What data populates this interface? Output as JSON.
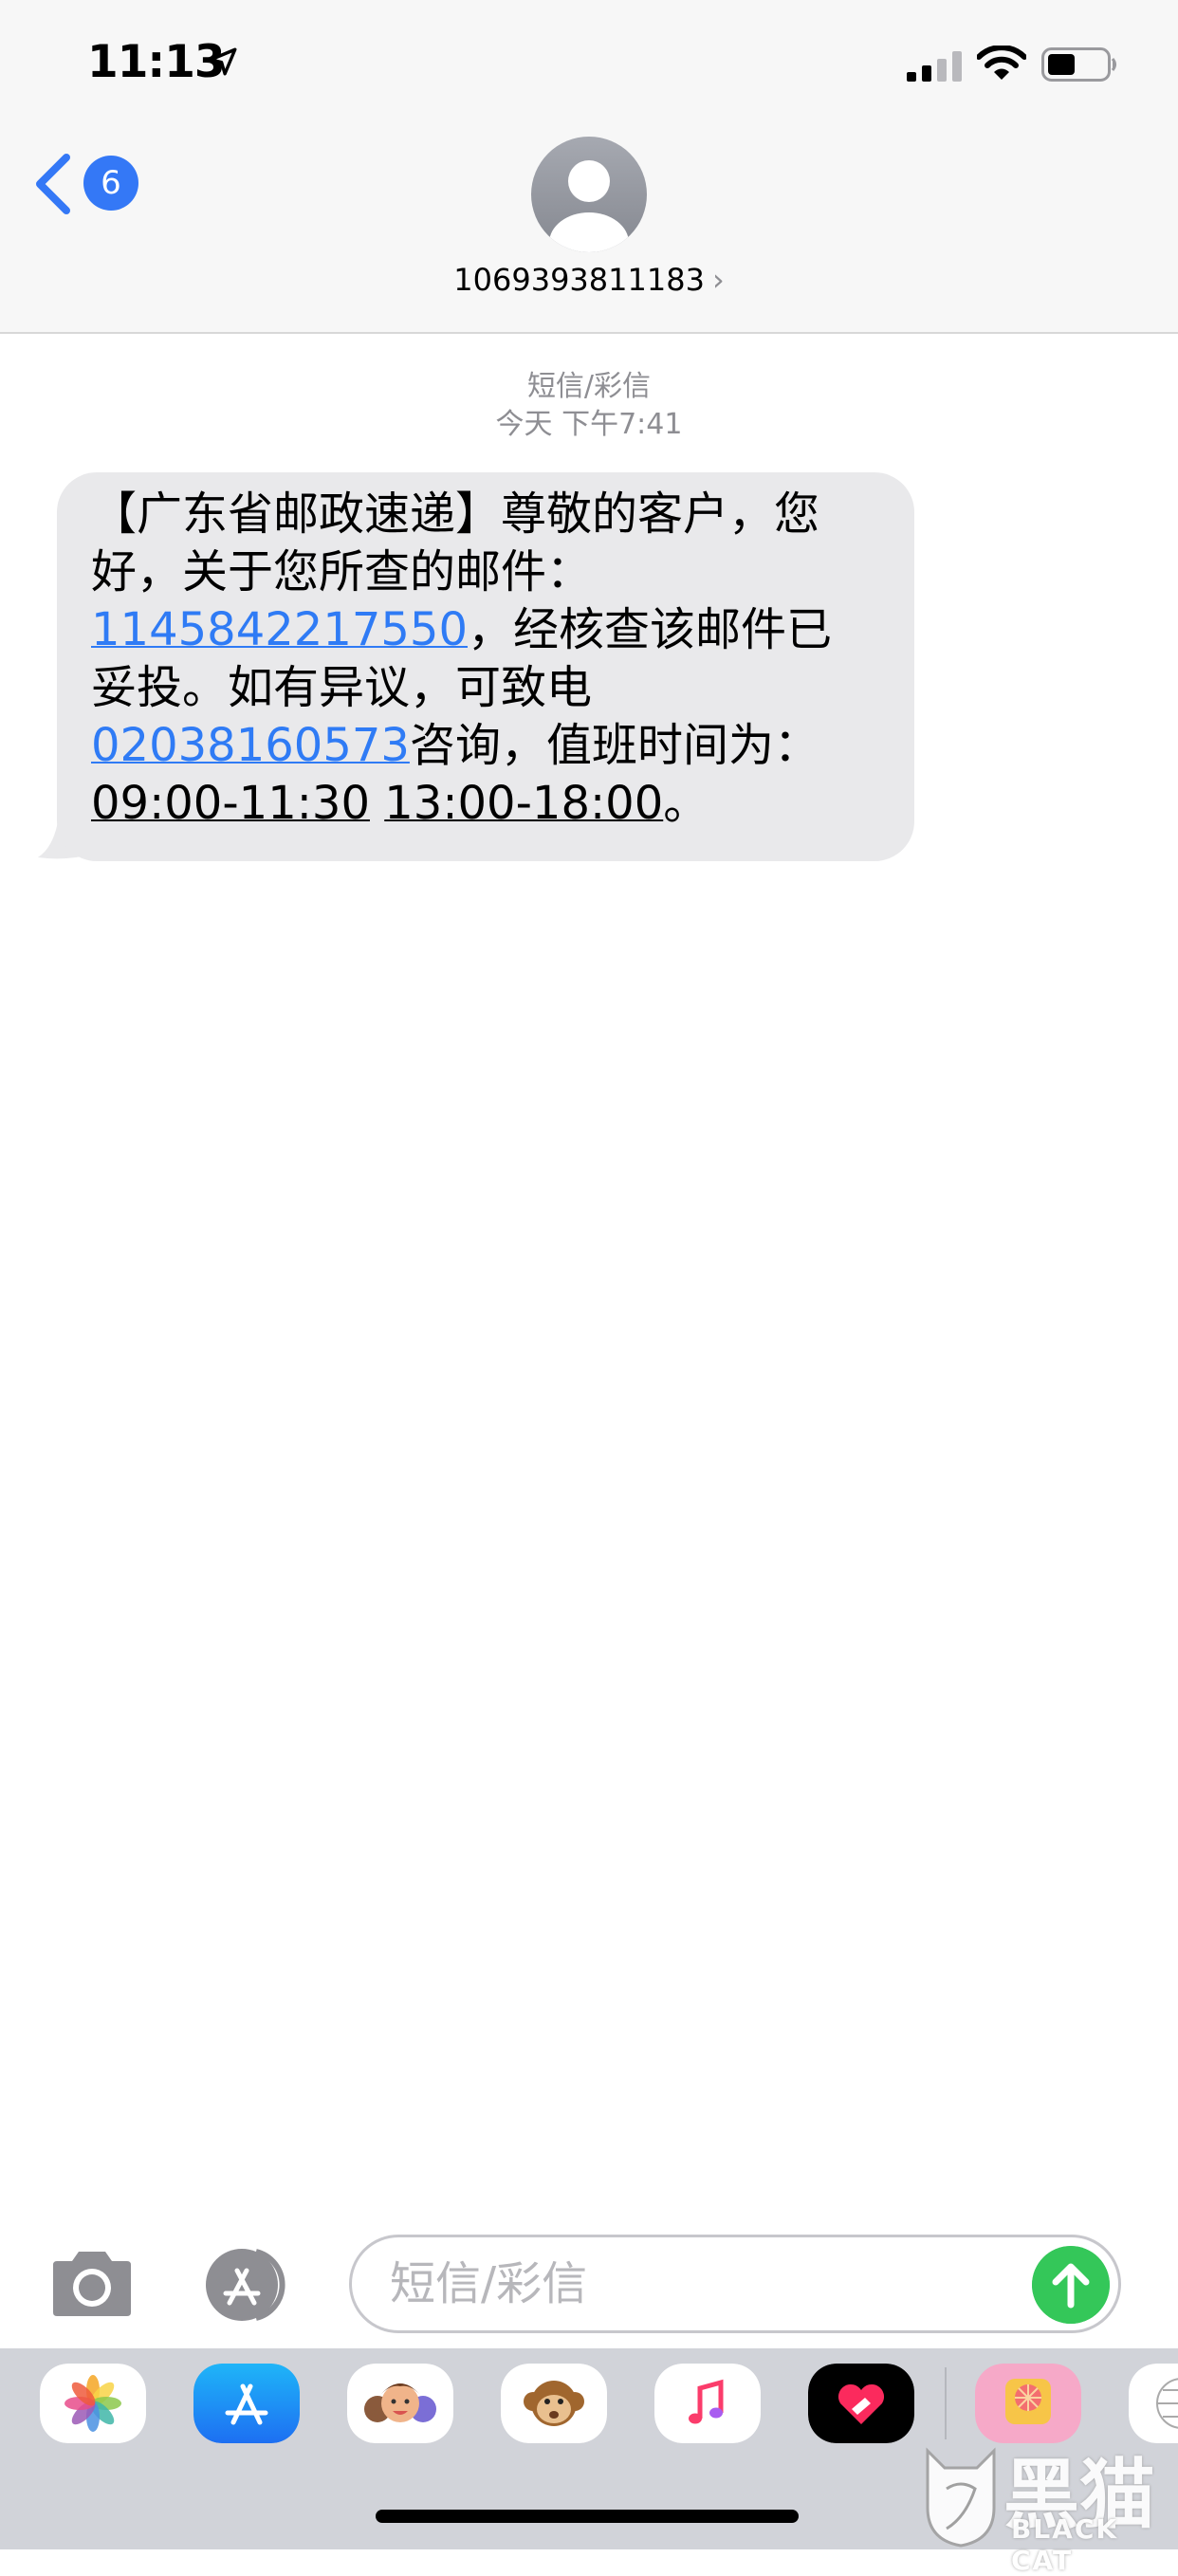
{
  "status_bar": {
    "time": "11:13",
    "location_icon": "location-arrow-icon",
    "signal_icon": "cellular-signal-icon",
    "wifi_icon": "wifi-icon",
    "battery_icon": "battery-icon"
  },
  "header": {
    "back_badge_count": "6",
    "contact_name": "1069393811183",
    "contact_chevron": "›"
  },
  "conversation": {
    "service_label": "短信/彩信",
    "timestamp": "今天 下午7:41",
    "message": {
      "line1": "【广东省邮政速递】尊敬的客户，您",
      "line2": "好，关于您所查的邮件：",
      "tracking_number": "1145842217550",
      "line3_rest": "，经核查该邮件已",
      "line4": "妥投。如有异议，可致电",
      "phone_number": "02038160573",
      "line5_rest": "咨询，值班时间为：",
      "hours_morning": "09:00-11:30",
      "hours_afternoon": "13:00-18:00",
      "line6_end": "。"
    }
  },
  "input_bar": {
    "placeholder": "短信/彩信",
    "camera_icon": "camera-icon",
    "apps_icon": "app-store-icon",
    "send_icon": "arrow-up-icon"
  },
  "app_drawer": {
    "apps": [
      "photos-icon",
      "app-store-icon",
      "memoji-icon",
      "animoji-monkey-icon",
      "music-icon",
      "digital-touch-icon",
      "sticker-app-icon",
      "globe-app-icon"
    ]
  },
  "watermark": {
    "cn": "黑猫",
    "en": "BLACK CAT"
  },
  "colors": {
    "accent": "#3478f6",
    "link": "#2f7bf5",
    "send": "#34c759",
    "bubble": "#e9e9eb",
    "header_bg": "#f7f7f7"
  }
}
